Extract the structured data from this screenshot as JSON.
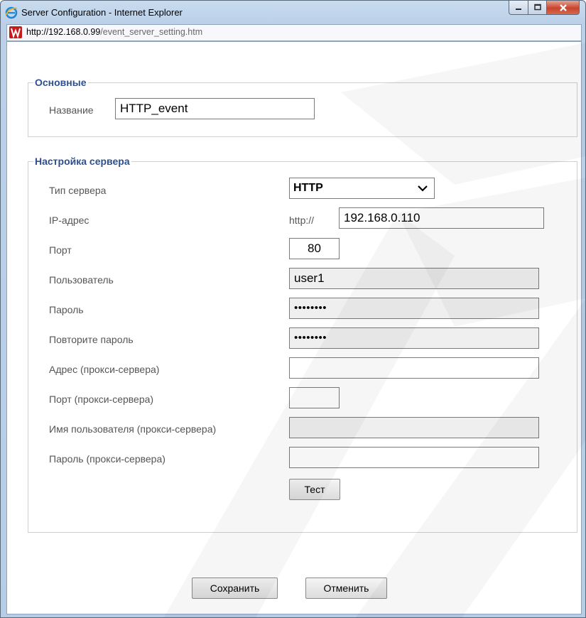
{
  "window": {
    "title": "Server Configuration - Internet Explorer",
    "url_scheme": "http://",
    "url_host": "192.168.0.99",
    "url_path": "/event_server_setting.htm"
  },
  "basic": {
    "legend": "Основные",
    "name_label": "Название",
    "name_value": "HTTP_event"
  },
  "server": {
    "legend": "Настройка сервера",
    "type_label": "Тип сервера",
    "type_value": "HTTP",
    "ip_label": "IP-адрес",
    "ip_prefix": "http://",
    "ip_value": "192.168.0.110",
    "port_label": "Порт",
    "port_value": "80",
    "user_label": "Пользователь",
    "user_value": "user1",
    "password_label": "Пароль",
    "password_value": "••••••••",
    "repeat_password_label": "Повторите пароль",
    "repeat_password_value": "••••••••",
    "proxy_address_label": "Адрес (прокси-сервера)",
    "proxy_address_value": "",
    "proxy_port_label": "Порт (прокси-сервера)",
    "proxy_port_value": "",
    "proxy_user_label": "Имя пользователя (прокси-сервера)",
    "proxy_user_value": "",
    "proxy_password_label": "Пароль (прокси-сервера)",
    "proxy_password_value": "",
    "test_button": "Тест"
  },
  "actions": {
    "save": "Сохранить",
    "cancel": "Отменить"
  },
  "icons": {
    "browser": "internet-explorer-icon",
    "site": "site-favicon-icon",
    "minimize": "minimize-icon",
    "maximize": "maximize-icon",
    "close": "close-icon",
    "dropdown": "chevron-down-icon"
  },
  "colors": {
    "legend": "#2e4f8f",
    "label": "#555555",
    "close_button": "#c9442b",
    "disabled_field": "#efefef"
  }
}
